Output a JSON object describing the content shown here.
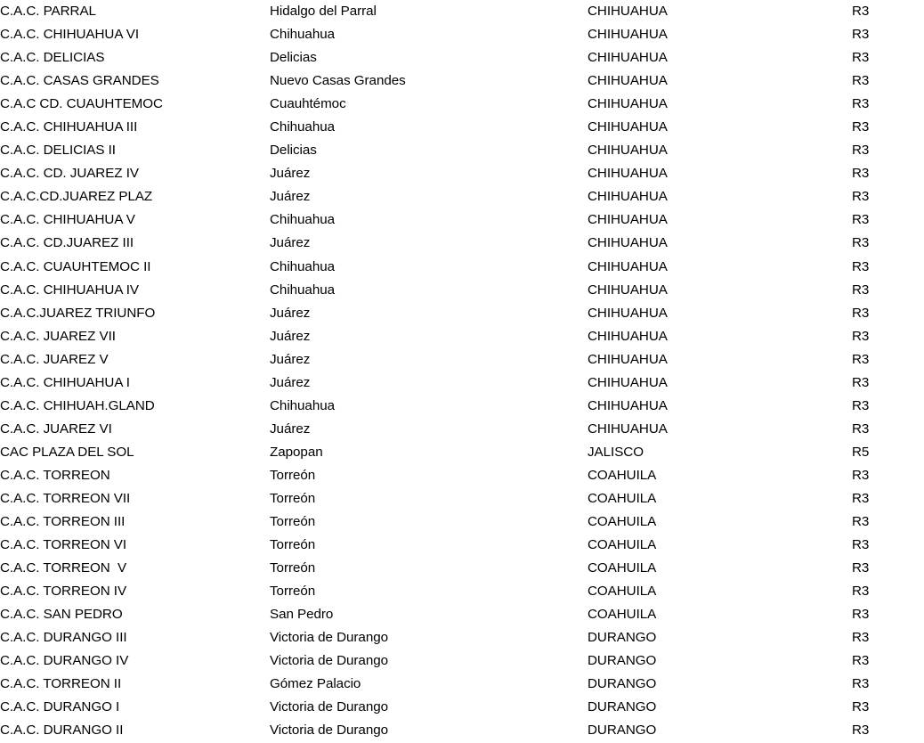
{
  "document": {
    "type": "table-listing",
    "background_color": "#ffffff",
    "text_color": "#000000",
    "columns": [
      {
        "key": "branch",
        "name": "branch-name"
      },
      {
        "key": "city",
        "name": "city"
      },
      {
        "key": "state",
        "name": "state"
      },
      {
        "key": "region",
        "name": "region-code"
      }
    ],
    "row_count": 32,
    "rows": [
      {
        "branch": "C.A.C. PARRAL",
        "city": "Hidalgo del Parral",
        "state": "CHIHUAHUA",
        "region": "R3"
      },
      {
        "branch": "C.A.C. CHIHUAHUA VI",
        "city": "Chihuahua",
        "state": "CHIHUAHUA",
        "region": "R3"
      },
      {
        "branch": "C.A.C. DELICIAS",
        "city": "Delicias",
        "state": "CHIHUAHUA",
        "region": "R3"
      },
      {
        "branch": "C.A.C. CASAS GRANDES",
        "city": "Nuevo Casas Grandes",
        "state": "CHIHUAHUA",
        "region": "R3"
      },
      {
        "branch": "C.A.C CD. CUAUHTEMOC",
        "city": "Cuauhtémoc",
        "state": "CHIHUAHUA",
        "region": "R3"
      },
      {
        "branch": "C.A.C. CHIHUAHUA III",
        "city": "Chihuahua",
        "state": "CHIHUAHUA",
        "region": "R3"
      },
      {
        "branch": "C.A.C. DELICIAS II",
        "city": "Delicias",
        "state": "CHIHUAHUA",
        "region": "R3"
      },
      {
        "branch": "C.A.C. CD. JUAREZ IV",
        "city": "Juárez",
        "state": "CHIHUAHUA",
        "region": "R3"
      },
      {
        "branch": "C.A.C.CD.JUAREZ PLAZ",
        "city": "Juárez",
        "state": "CHIHUAHUA",
        "region": "R3"
      },
      {
        "branch": "C.A.C. CHIHUAHUA V",
        "city": "Chihuahua",
        "state": "CHIHUAHUA",
        "region": "R3"
      },
      {
        "branch": "C.A.C. CD.JUAREZ III",
        "city": "Juárez",
        "state": "CHIHUAHUA",
        "region": "R3"
      },
      {
        "branch": "C.A.C. CUAUHTEMOC II",
        "city": "Chihuahua",
        "state": "CHIHUAHUA",
        "region": "R3"
      },
      {
        "branch": "C.A.C. CHIHUAHUA IV",
        "city": "Chihuahua",
        "state": "CHIHUAHUA",
        "region": "R3"
      },
      {
        "branch": "C.A.C.JUAREZ TRIUNFO",
        "city": "Juárez",
        "state": "CHIHUAHUA",
        "region": "R3"
      },
      {
        "branch": "C.A.C. JUAREZ VII",
        "city": "Juárez",
        "state": "CHIHUAHUA",
        "region": "R3"
      },
      {
        "branch": "C.A.C. JUAREZ V",
        "city": "Juárez",
        "state": "CHIHUAHUA",
        "region": "R3"
      },
      {
        "branch": "C.A.C. CHIHUAHUA I",
        "city": "Juárez",
        "state": "CHIHUAHUA",
        "region": "R3"
      },
      {
        "branch": "C.A.C. CHIHUAH.GLAND",
        "city": "Chihuahua",
        "state": "CHIHUAHUA",
        "region": "R3"
      },
      {
        "branch": "C.A.C. JUAREZ VI",
        "city": "Juárez",
        "state": "CHIHUAHUA",
        "region": "R3"
      },
      {
        "branch": "CAC PLAZA DEL SOL",
        "city": "Zapopan",
        "state": "JALISCO",
        "region": "R5"
      },
      {
        "branch": "C.A.C. TORREON",
        "city": "Torreón",
        "state": "COAHUILA",
        "region": "R3"
      },
      {
        "branch": "C.A.C. TORREON VII",
        "city": "Torreón",
        "state": "COAHUILA",
        "region": "R3"
      },
      {
        "branch": "C.A.C. TORREON III",
        "city": "Torreón",
        "state": "COAHUILA",
        "region": "R3"
      },
      {
        "branch": "C.A.C. TORREON VI",
        "city": "Torreón",
        "state": "COAHUILA",
        "region": "R3"
      },
      {
        "branch": "C.A.C. TORREON  V",
        "city": "Torreón",
        "state": "COAHUILA",
        "region": "R3"
      },
      {
        "branch": "C.A.C. TORREON IV",
        "city": "Torreón",
        "state": "COAHUILA",
        "region": "R3"
      },
      {
        "branch": "C.A.C. SAN PEDRO",
        "city": "San Pedro",
        "state": "COAHUILA",
        "region": "R3"
      },
      {
        "branch": "C.A.C. DURANGO III",
        "city": "Victoria de Durango",
        "state": "DURANGO",
        "region": "R3"
      },
      {
        "branch": "C.A.C. DURANGO IV",
        "city": "Victoria de Durango",
        "state": "DURANGO",
        "region": "R3"
      },
      {
        "branch": "C.A.C. TORREON II",
        "city": "Gómez Palacio",
        "state": "DURANGO",
        "region": "R3"
      },
      {
        "branch": "C.A.C. DURANGO I",
        "city": "Victoria de Durango",
        "state": "DURANGO",
        "region": "R3"
      },
      {
        "branch": "C.A.C. DURANGO II",
        "city": "Victoria de Durango",
        "state": "DURANGO",
        "region": "R3"
      }
    ]
  }
}
